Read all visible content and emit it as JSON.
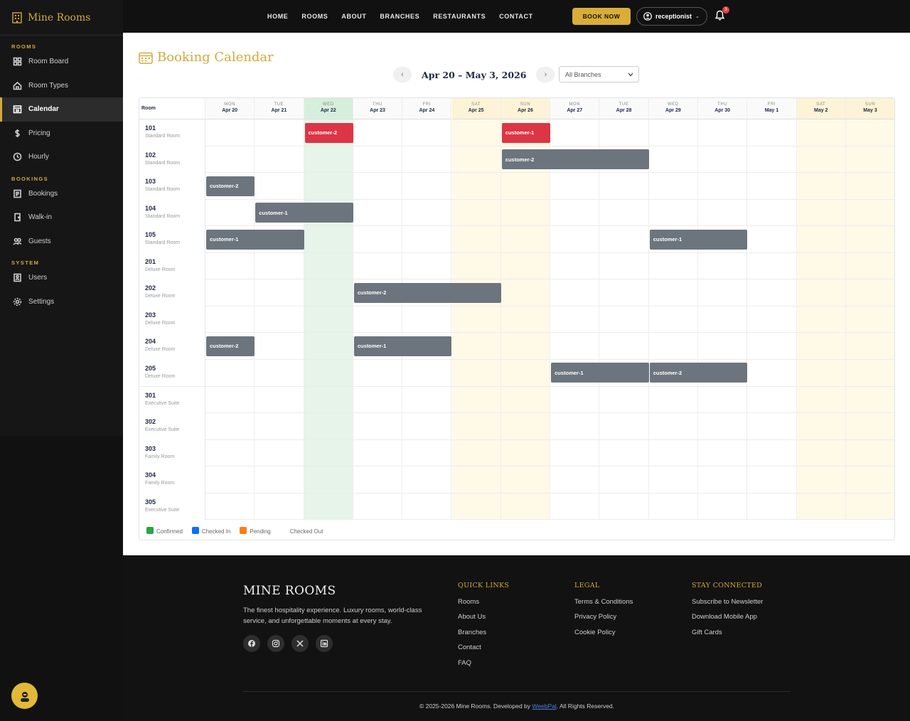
{
  "sidebar": {
    "brand": "Mine Rooms",
    "sections": [
      {
        "title": "ROOMS",
        "items": [
          {
            "label": "Room Board",
            "icon": "grid-icon"
          },
          {
            "label": "Room Types",
            "icon": "home-icon"
          },
          {
            "label": "Calendar",
            "icon": "calendar-icon",
            "active": true
          },
          {
            "label": "Pricing",
            "icon": "dollar-icon"
          },
          {
            "label": "Hourly",
            "icon": "clock-icon"
          }
        ]
      },
      {
        "title": "BOOKINGS",
        "items": [
          {
            "label": "Bookings",
            "icon": "list-icon"
          },
          {
            "label": "Walk-in",
            "icon": "walkin-icon"
          },
          {
            "label": "Guests",
            "icon": "users-icon"
          }
        ]
      },
      {
        "title": "SYSTEM",
        "items": [
          {
            "label": "Users",
            "icon": "user-card-icon"
          },
          {
            "label": "Settings",
            "icon": "gear-icon"
          }
        ]
      }
    ]
  },
  "topnav": {
    "links": [
      "HOME",
      "ROOMS",
      "ABOUT",
      "BRANCHES",
      "RESTAURANTS",
      "CONTACT"
    ],
    "book_now": "BOOK NOW",
    "user": "receptionist",
    "notifications": "3"
  },
  "calendar": {
    "title": "Booking Calendar",
    "range": "Apr 20 – May 3, 2026",
    "branch_select": "All Branches",
    "room_header": "Room",
    "days": [
      {
        "dow": "MON",
        "date": "Apr 20",
        "kind": "normal"
      },
      {
        "dow": "TUE",
        "date": "Apr 21",
        "kind": "normal"
      },
      {
        "dow": "WED",
        "date": "Apr 22",
        "kind": "today"
      },
      {
        "dow": "THU",
        "date": "Apr 23",
        "kind": "normal"
      },
      {
        "dow": "FRI",
        "date": "Apr 24",
        "kind": "normal"
      },
      {
        "dow": "SAT",
        "date": "Apr 25",
        "kind": "weekend"
      },
      {
        "dow": "SUN",
        "date": "Apr 26",
        "kind": "weekend"
      },
      {
        "dow": "MON",
        "date": "Apr 27",
        "kind": "normal"
      },
      {
        "dow": "TUE",
        "date": "Apr 28",
        "kind": "normal"
      },
      {
        "dow": "WED",
        "date": "Apr 29",
        "kind": "normal"
      },
      {
        "dow": "THU",
        "date": "Apr 30",
        "kind": "normal"
      },
      {
        "dow": "FRI",
        "date": "May 1",
        "kind": "normal"
      },
      {
        "dow": "SAT",
        "date": "May 2",
        "kind": "weekend"
      },
      {
        "dow": "SUN",
        "date": "May 3",
        "kind": "weekend"
      }
    ],
    "rooms": [
      {
        "number": "101",
        "type": "Standard Room"
      },
      {
        "number": "102",
        "type": "Standard Room"
      },
      {
        "number": "103",
        "type": "Standard Room"
      },
      {
        "number": "104",
        "type": "Standard Room"
      },
      {
        "number": "105",
        "type": "Standard Room"
      },
      {
        "number": "201",
        "type": "Deluxe Room"
      },
      {
        "number": "202",
        "type": "Deluxe Room"
      },
      {
        "number": "203",
        "type": "Deluxe Room"
      },
      {
        "number": "204",
        "type": "Deluxe Room"
      },
      {
        "number": "205",
        "type": "Deluxe Room"
      },
      {
        "number": "301",
        "type": "Executive Suite"
      },
      {
        "number": "302",
        "type": "Executive Suite"
      },
      {
        "number": "303",
        "type": "Family Room"
      },
      {
        "number": "304",
        "type": "Family Room"
      },
      {
        "number": "305",
        "type": "Executive Suite"
      }
    ],
    "bookings": [
      {
        "room": 0,
        "start": 2,
        "days": 1,
        "guest": "customer-2",
        "color": "#dc3545"
      },
      {
        "room": 0,
        "start": 6,
        "days": 1,
        "guest": "customer-1",
        "color": "#dc3545"
      },
      {
        "room": 1,
        "start": 6,
        "days": 3,
        "guest": "customer-2",
        "color": "#6c757d"
      },
      {
        "room": 2,
        "start": 0,
        "days": 1,
        "guest": "customer-2",
        "color": "#6c757d"
      },
      {
        "room": 3,
        "start": 1,
        "days": 2,
        "guest": "customer-1",
        "color": "#6c757d"
      },
      {
        "room": 4,
        "start": 0,
        "days": 2,
        "guest": "customer-1",
        "color": "#6c757d"
      },
      {
        "room": 4,
        "start": 9,
        "days": 2,
        "guest": "customer-1",
        "color": "#6c757d"
      },
      {
        "room": 6,
        "start": 3,
        "days": 3,
        "guest": "customer-2",
        "color": "#6c757d"
      },
      {
        "room": 8,
        "start": 0,
        "days": 1,
        "guest": "customer-2",
        "color": "#6c757d"
      },
      {
        "room": 8,
        "start": 3,
        "days": 2,
        "guest": "customer-1",
        "color": "#6c757d"
      },
      {
        "room": 9,
        "start": 7,
        "days": 2,
        "guest": "customer-1",
        "color": "#6c757d"
      },
      {
        "room": 9,
        "start": 9,
        "days": 2,
        "guest": "customer-2",
        "color": "#6c757d"
      }
    ],
    "legend": [
      {
        "label": "Confirmed",
        "color": "#28a745"
      },
      {
        "label": "Checked In",
        "color": "#0d6efd"
      },
      {
        "label": "Pending",
        "color": "#fd7e14"
      },
      {
        "label": "Checked Out",
        "color": ""
      }
    ]
  },
  "footer": {
    "brand": "MINE ROOMS",
    "description": "The finest hospitality experience. Luxury rooms, world-class service, and unforgettable moments at every stay.",
    "social": [
      "facebook-icon",
      "instagram-icon",
      "x-icon",
      "linkedin-icon"
    ],
    "columns": [
      {
        "title": "QUICK LINKS",
        "links": [
          "Rooms",
          "About Us",
          "Branches",
          "Contact",
          "FAQ"
        ]
      },
      {
        "title": "LEGAL",
        "links": [
          "Terms & Conditions",
          "Privacy Policy",
          "Cookie Policy"
        ]
      },
      {
        "title": "STAY CONNECTED",
        "links": [
          "Subscribe to Newsletter",
          "Download Mobile App",
          "Gift Cards"
        ]
      }
    ],
    "copyright_pre": "© 2025-2026 Mine Rooms. Developed by ",
    "copyright_link": "WeebPal",
    "copyright_post": ". All Rights Reserved."
  }
}
